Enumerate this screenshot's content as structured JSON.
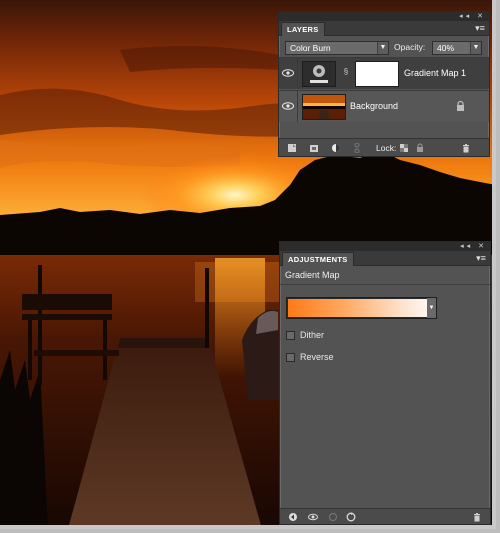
{
  "layers_panel": {
    "tab_label": "LAYERS",
    "blend_mode": "Color Burn",
    "opacity_label": "Opacity:",
    "opacity_value": "40%",
    "lock_label": "Lock:",
    "layers": [
      {
        "name": "Gradient Map 1",
        "visible": true,
        "selected": true
      },
      {
        "name": "Background",
        "visible": true,
        "locked": true
      }
    ]
  },
  "adjustments_panel": {
    "tab_label": "ADJUSTMENTS",
    "title": "Gradient Map",
    "gradient_colors": [
      "#ff7a16",
      "#fff6ee"
    ],
    "options": [
      {
        "label": "Dither",
        "checked": false
      },
      {
        "label": "Reverse",
        "checked": false
      }
    ]
  },
  "colors": {
    "panel_bg": "#535353",
    "panel_dark": "#2c2c2c",
    "sunset_orange": "#ff8a1a"
  }
}
